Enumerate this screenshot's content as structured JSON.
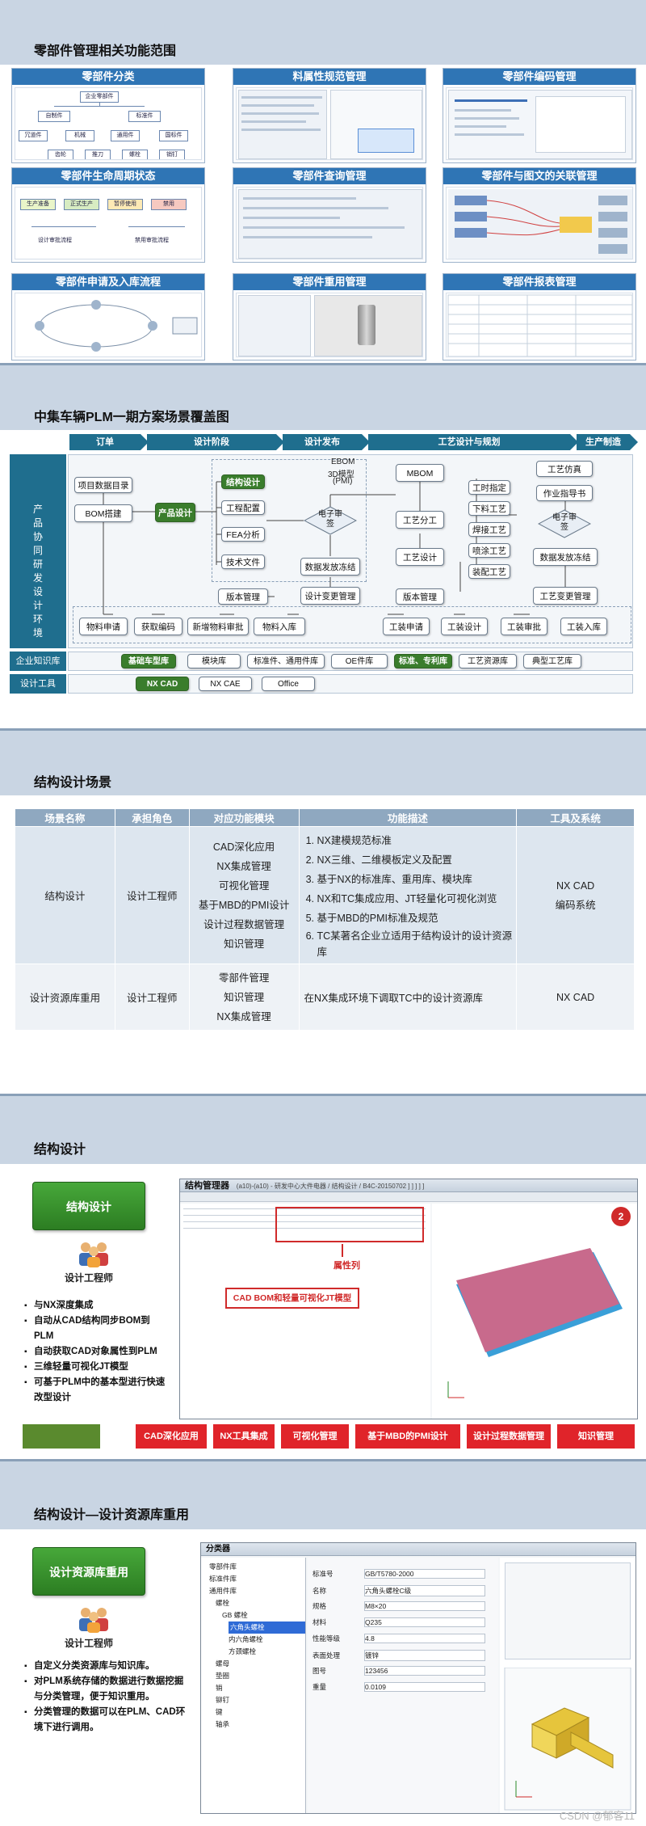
{
  "slide1": {
    "title": "零部件管理相关功能范围",
    "panels": {
      "classify": "零部件分类",
      "lifecycle": "零部件生命周期状态",
      "apply": "零部件申请及入库流程",
      "spec": "料属性规范管理",
      "query": "零部件查询管理",
      "reuse": "零部件重用管理",
      "coding": "零部件编码管理",
      "relation": "零部件与图文的关联管理",
      "report": "零部件报表管理"
    },
    "classify_tree": {
      "root": "企业零部件",
      "level2": [
        "自制件",
        "标准件"
      ],
      "level3": [
        "冗道件",
        "机械",
        "通用件",
        "国标件"
      ],
      "level4": [
        "齿轮",
        "推刀",
        "螺栓",
        "销钉"
      ]
    },
    "lifecycle_states": [
      "生产准备",
      "正式生产",
      "暂停使用",
      "禁用"
    ],
    "lifecycle_captions": [
      "设计审批流程",
      "禁用审批流程"
    ]
  },
  "slide2": {
    "title": "中集车辆PLM一期方案场景覆盖图",
    "phases": [
      "订单",
      "设计阶段",
      "设计发布",
      "工艺设计与规划",
      "生产制造"
    ],
    "left_labels": {
      "env": "产品协同研发设计环境",
      "knowledge": "企业知识库",
      "tools": "设计工具"
    },
    "nodes": {
      "project_dir": "项目数据目录",
      "bom_build": "BOM搭建",
      "product_design": "产品设计",
      "structure_design": "结构设计",
      "config": "工程配置",
      "fea": "FEA分析",
      "tech_doc": "技术文件",
      "review1": "电子审签",
      "data_release": "数据发放冻结",
      "change": "设计变更管理",
      "version": "版本管理",
      "ebom": "EBOM",
      "ebom_3d": "3D模型",
      "ebom_pmi": "(PMI)",
      "mbom": "MBOM",
      "proc_divide": "工艺分工",
      "proc_design": "工艺设计",
      "proc_version": "版本管理",
      "hour": "工时指定",
      "blanking": "下料工艺",
      "welding": "焊接工艺",
      "painting": "喷涂工艺",
      "assembly": "装配工艺",
      "proc_sim": "工艺仿真",
      "work_guide": "作业指导书",
      "review2": "电子审签",
      "proc_release": "数据发放冻结",
      "proc_change": "工艺变更管理",
      "mat_apply": "物料申请",
      "get_code": "获取编码",
      "new_mat": "新增物料审批",
      "mat_store": "物料入库",
      "tool_apply": "工装申请",
      "tool_design": "工装设计",
      "tool_approve": "工装审批",
      "tool_store": "工装入库"
    },
    "knowledge": [
      "基础车型库",
      "模块库",
      "标准件、通用件库",
      "OE件库",
      "标准、专利库",
      "工艺资源库",
      "典型工艺库"
    ],
    "tools": [
      "NX CAD",
      "NX CAE",
      "Office"
    ]
  },
  "slide3": {
    "title": "结构设计场景",
    "headers": [
      "场景名称",
      "承担角色",
      "对应功能模块",
      "功能描述",
      "工具及系统"
    ],
    "rows": [
      {
        "name": "结构设计",
        "role": "设计工程师",
        "modules": [
          "CAD深化应用",
          "NX集成管理",
          "可视化管理",
          "基于MBD的PMI设计",
          "设计过程数据管理",
          "知识管理"
        ],
        "desc": [
          "NX建模规范标准",
          "NX三维、二维模板定义及配置",
          "基于NX的标准库、重用库、模块库",
          "NX和TC集成应用、JT轻量化可视化浏览",
          "基于MBD的PMI标准及规范",
          "TC某著名企业立适用于结构设计的设计资源库"
        ],
        "tools": [
          "NX CAD",
          "编码系统"
        ]
      },
      {
        "name": "设计资源库重用",
        "role": "设计工程师",
        "modules": [
          "零部件管理",
          "知识管理",
          "NX集成管理"
        ],
        "desc": [
          "在NX集成环境下调取TC中的设计资源库"
        ],
        "tools": [
          "NX CAD"
        ]
      }
    ]
  },
  "slide4": {
    "title": "结构设计",
    "button": "结构设计",
    "role": "设计工程师",
    "features": [
      "与NX深度集成",
      "自动从CAD结构同步BOM到PLM",
      "自动获取CAD对象属性到PLM",
      "三维轻量可视化JT模型",
      "可基于PLM中的基本型进行快速改型设计"
    ],
    "window_title": "结构管理器",
    "window_path": "(a10)-(a10) - 研发中心大件电器 / 结构设计 / B4C-20150702 ] ] ] ] ]",
    "attr_label": "属性列",
    "callout": "CAD BOM和轻量可视化JT模型",
    "badge": "2",
    "bottom_buttons": [
      "CAD深化应用",
      "NX工具集成",
      "可视化管理",
      "基于MBD的PMI设计",
      "设计过程数据管理",
      "知识管理"
    ]
  },
  "slide5": {
    "title": "结构设计—设计资源库重用",
    "button": "设计资源库重用",
    "role": "设计工程师",
    "features": [
      "自定义分类资源库与知识库。",
      "对PLM系统存储的数据进行数据挖掘与分类管理，便于知识重用。",
      "分类管理的数据可以在PLM、CAD环境下进行调用。"
    ],
    "panel_title": "分类器",
    "tree_items": [
      "零部件库",
      "标准件库",
      "通用件库",
      "螺栓",
      "GB 螺栓",
      "六角头螺栓",
      "内六角螺栓",
      "方颈螺栓",
      "螺母",
      "垫圈",
      "销",
      "铆钉",
      "键",
      "轴承"
    ],
    "prop_labels": [
      "标准号",
      "名称",
      "规格",
      "材料",
      "性能等级",
      "表面处理",
      "图号",
      "重量"
    ],
    "prop_values": [
      "GB/T5780-2000",
      "六角头螺栓C级",
      "M8×20",
      "Q235",
      "4.8",
      "镀锌",
      "123456",
      "0.0109"
    ]
  },
  "watermark": "CSDN @郁客11"
}
